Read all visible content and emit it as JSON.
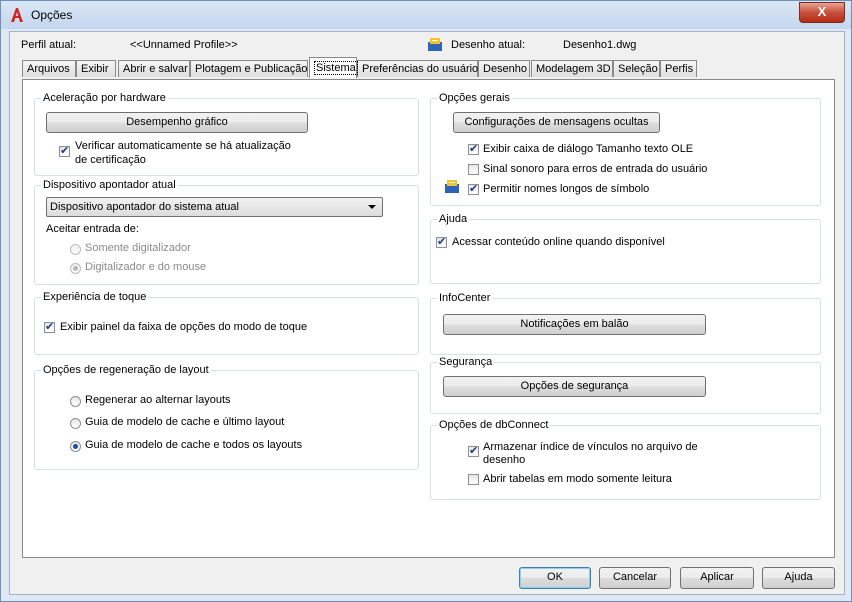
{
  "window": {
    "title": "Opções",
    "close_label": "X"
  },
  "header": {
    "profile_label": "Perfil atual:",
    "profile_value": "<<Unnamed Profile>>",
    "drawing_label": "Desenho atual:",
    "drawing_value": "Desenho1.dwg"
  },
  "tabs": [
    "Arquivos",
    "Exibir",
    "Abrir e salvar",
    "Plotagem e Publicação",
    "Sistema",
    "Preferências do usuário",
    "Desenho",
    "Modelagem 3D",
    "Seleção",
    "Perfis"
  ],
  "hardware": {
    "title": "Aceleração por hardware",
    "button": "Desempenho gráfico",
    "check_label_1": "Verificar automaticamente se há atualização",
    "check_label_2": "de certificação",
    "check_on": true
  },
  "pointing": {
    "title": "Dispositivo apontador atual",
    "selected": "Dispositivo apontador do sistema atual",
    "accept_label": "Aceitar entrada de:",
    "opt1": "Somente digitalizador",
    "opt2": "Digitalizador e do mouse"
  },
  "touch": {
    "title": "Experiência de toque",
    "check_label": "Exibir painel da faixa de opções do modo de toque"
  },
  "regen": {
    "title": "Opções de regeneração de layout",
    "opt1": "Regenerar ao alternar layouts",
    "opt2": "Guia de modelo de cache e último layout",
    "opt3": "Guia de modelo de cache e todos os layouts"
  },
  "general": {
    "title": "Opções gerais",
    "button": "Configurações de mensagens ocultas",
    "check1": "Exibir caixa de diálogo Tamanho texto OLE",
    "check2": "Sinal sonoro para erros de entrada do usuário",
    "check3": "Permitir nomes longos de símbolo"
  },
  "help": {
    "title": "Ajuda",
    "check": "Acessar conteúdo online quando disponível"
  },
  "infocenter": {
    "title": "InfoCenter",
    "button": "Notificações em balão"
  },
  "security": {
    "title": "Segurança",
    "button": "Opções de segurança"
  },
  "dbconnect": {
    "title": "Opções de dbConnect",
    "check1_line1": "Armazenar índice de vínculos no arquivo de",
    "check1_line2": "desenho",
    "check2": "Abrir tabelas em modo somente leitura"
  },
  "footer": {
    "ok": "OK",
    "cancel": "Cancelar",
    "apply": "Aplicar",
    "help": "Ajuda"
  },
  "colors": {
    "accent": "#3c7fb1",
    "close": "#c7503c",
    "app_icon": "#d0251d"
  }
}
